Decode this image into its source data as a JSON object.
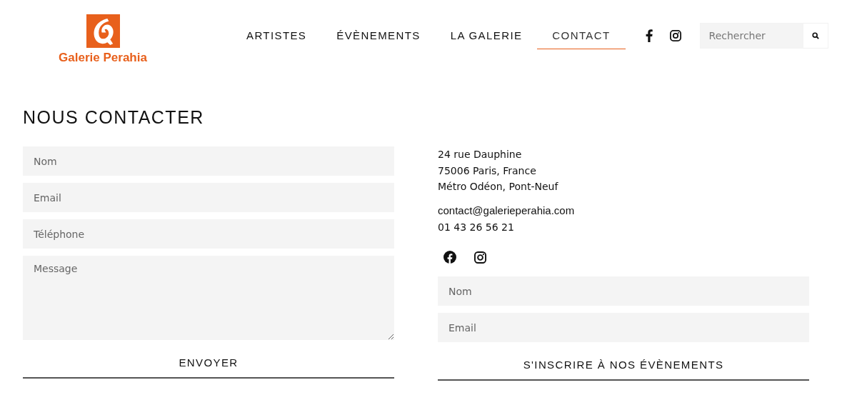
{
  "logo": {
    "name": "Galerie Perahia"
  },
  "nav": [
    {
      "label": "ARTISTES",
      "selected": false
    },
    {
      "label": "ÉVÈNEMENTS",
      "selected": false
    },
    {
      "label": "LA GALERIE",
      "selected": false
    },
    {
      "label": "CONTACT",
      "selected": true
    }
  ],
  "search": {
    "placeholder": "Rechercher"
  },
  "title": "NOUS CONTACTER",
  "contact_form": {
    "fields": [
      {
        "kind": "input",
        "placeholder": "Nom"
      },
      {
        "kind": "input",
        "placeholder": "Email"
      },
      {
        "kind": "input",
        "placeholder": "Téléphone"
      },
      {
        "kind": "textarea",
        "placeholder": "Message"
      }
    ],
    "submit": "ENVOYER"
  },
  "address": [
    "24 rue Dauphine",
    "75006 Paris, France",
    "Métro Odéon, Pont-Neuf"
  ],
  "email": "contact@galerieperahia.com",
  "phone": "01 43 26 56 21",
  "newsletter": {
    "fields": [
      {
        "kind": "input",
        "placeholder": "Nom"
      },
      {
        "kind": "input",
        "placeholder": "Email"
      }
    ],
    "submit": "S'INSCRIRE À NOS ÉVÈNEMENTS"
  }
}
